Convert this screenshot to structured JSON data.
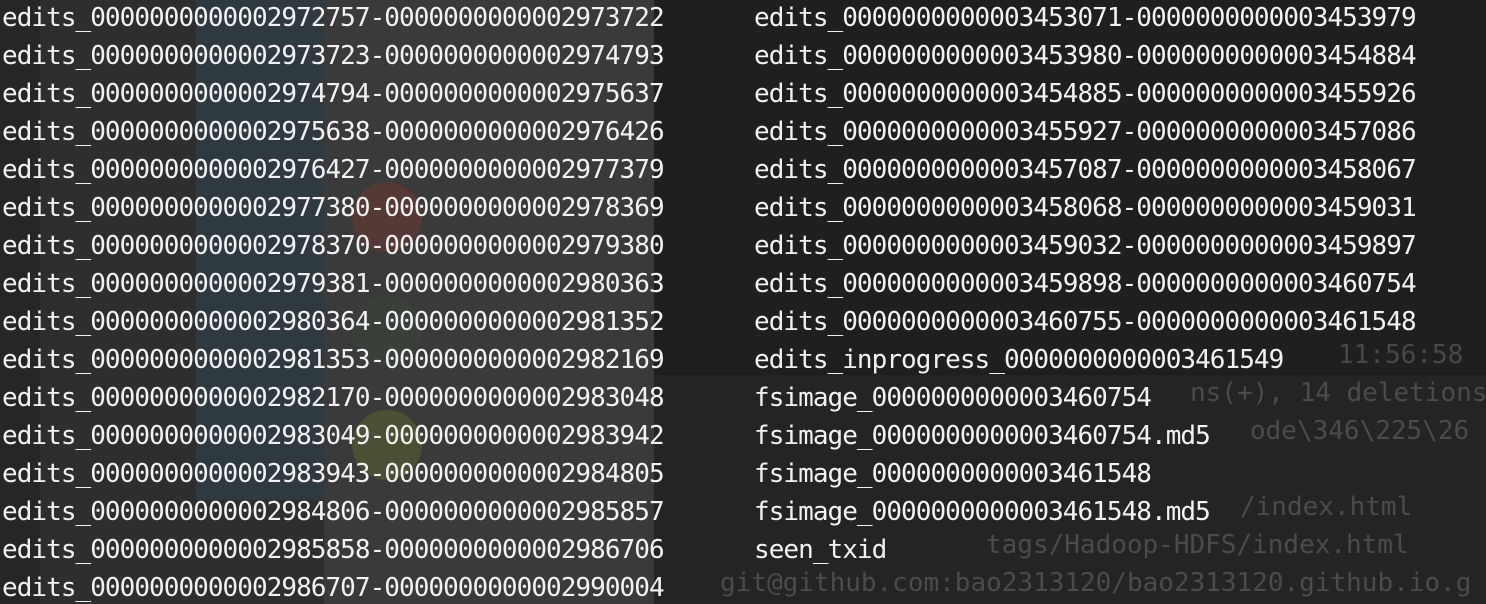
{
  "terminal": {
    "left_column": [
      "edits_0000000000002972757-0000000000002973722",
      "edits_0000000000002973723-0000000000002974793",
      "edits_0000000000002974794-0000000000002975637",
      "edits_0000000000002975638-0000000000002976426",
      "edits_0000000000002976427-0000000000002977379",
      "edits_0000000000002977380-0000000000002978369",
      "edits_0000000000002978370-0000000000002979380",
      "edits_0000000000002979381-0000000000002980363",
      "edits_0000000000002980364-0000000000002981352",
      "edits_0000000000002981353-0000000000002982169",
      "edits_0000000000002982170-0000000000002983048",
      "edits_0000000000002983049-0000000000002983942",
      "edits_0000000000002983943-0000000000002984805",
      "edits_0000000000002984806-0000000000002985857",
      "edits_0000000000002985858-0000000000002986706",
      "edits_0000000000002986707-0000000000002990004"
    ],
    "right_column": [
      "edits_0000000000003453071-0000000000003453979",
      "edits_0000000000003453980-0000000000003454884",
      "edits_0000000000003454885-0000000000003455926",
      "edits_0000000000003455927-0000000000003457086",
      "edits_0000000000003457087-0000000000003458067",
      "edits_0000000000003458068-0000000000003459031",
      "edits_0000000000003459032-0000000000003459897",
      "edits_0000000000003459898-0000000000003460754",
      "edits_0000000000003460755-0000000000003461548",
      "edits_inprogress_0000000000003461549",
      "fsimage_0000000000003460754",
      "fsimage_0000000000003460754.md5",
      "fsimage_0000000000003461548",
      "fsimage_0000000000003461548.md5",
      "seen_txid"
    ]
  },
  "background": {
    "faint_lines": [
      "11:56:58",
      "ns(+), 14 deletions(",
      "ode\\346\\225\\26",
      "/index.html",
      "tags/Hadoop-HDFS/index.html",
      "git@github.com:bao2313120/bao2313120.github.io.g"
    ]
  },
  "colors": {
    "text": "#f2f2f2",
    "background": "#2e2e2e"
  }
}
